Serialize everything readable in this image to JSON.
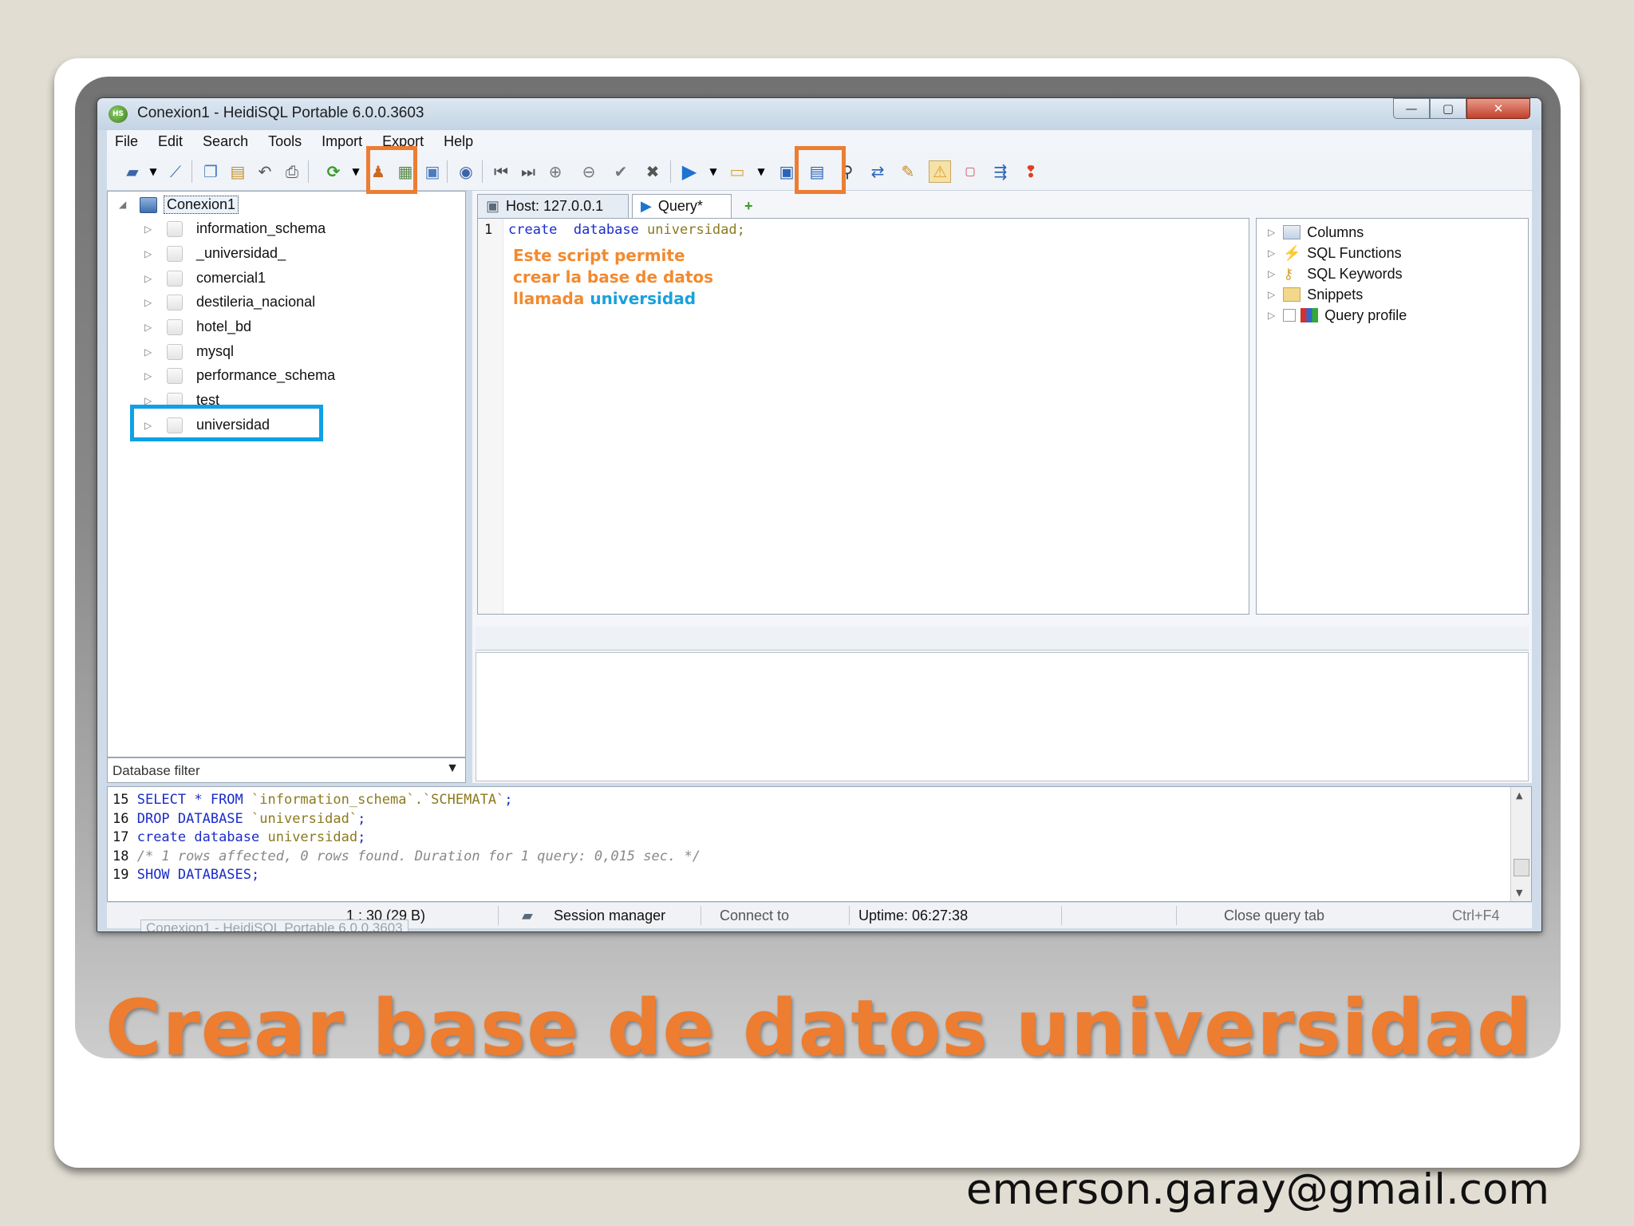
{
  "window": {
    "title": "Conexion1 - HeidiSQL Portable 6.0.0.3603",
    "icon_text": "HS",
    "controls": {
      "minimize": "—",
      "maximize": "▢",
      "close": "✕"
    }
  },
  "menu": [
    "File",
    "Edit",
    "Search",
    "Tools",
    "Import",
    "Export",
    "Help"
  ],
  "toolbar": {
    "icons": [
      "connect-icon",
      "dropdown-icon",
      "disconnect-icon",
      "copy-icon",
      "paste-icon",
      "undo-icon",
      "print-icon",
      "refresh-icon",
      "dropdown-icon",
      "user-manager-icon",
      "export-grid-icon",
      "import-icon",
      "help-icon",
      "first-record-icon",
      "last-record-icon",
      "insert-record-icon",
      "delete-record-icon",
      "post-icon",
      "cancel-icon",
      "run-query-icon",
      "dropdown-icon",
      "load-sql-icon",
      "dropdown-icon",
      "save-icon",
      "save-as-icon",
      "search-icon",
      "replace-icon",
      "format-icon",
      "warning-icon",
      "sql-log-icon",
      "wrap-icon",
      "stop-icon"
    ],
    "highlight_color_orange": "#ed7d31",
    "highlight_color_blue": "#0fa0e6"
  },
  "tree": {
    "root": "Conexion1",
    "databases": [
      "information_schema",
      "_universidad_",
      "comercial1",
      "destileria_nacional",
      "hotel_bd",
      "mysql",
      "performance_schema",
      "test",
      "universidad"
    ],
    "highlighted": "universidad"
  },
  "db_filter": {
    "placeholder": "Database filter",
    "arrow": "▼"
  },
  "tabs": {
    "host": "Host: 127.0.0.1",
    "query": "Query*",
    "add": "+"
  },
  "editor": {
    "line_number": "1",
    "code": {
      "kw1": "create",
      "kw2": "database",
      "ident": "universidad;"
    },
    "annotation": {
      "line1": "Este script permite",
      "line2": "crear la base de datos",
      "line3_prefix": "llamada",
      "line3_highlight": "universidad",
      "color": "#f28a30",
      "highlight_color": "#19a0dc"
    }
  },
  "helpers": [
    "Columns",
    "SQL Functions",
    "SQL Keywords",
    "Snippets",
    "Query profile"
  ],
  "log": [
    {
      "num": "15",
      "parts": [
        [
          "kw",
          "SELECT * FROM "
        ],
        [
          "str",
          "`information_schema`.`SCHEMATA`"
        ],
        [
          "kw",
          ";"
        ]
      ]
    },
    {
      "num": "16",
      "parts": [
        [
          "kw",
          "DROP DATABASE "
        ],
        [
          "str",
          "`universidad`"
        ],
        [
          "kw",
          ";"
        ]
      ]
    },
    {
      "num": "17",
      "parts": [
        [
          "kw",
          "create database "
        ],
        [
          "str",
          "universidad"
        ],
        [
          "kw",
          ";"
        ]
      ]
    },
    {
      "num": "18",
      "parts": [
        [
          "cmt",
          "/* 1 rows affected, 0 rows found. Duration for 1 query: 0,015 sec. */"
        ]
      ]
    },
    {
      "num": "19",
      "parts": [
        [
          "kw",
          "SHOW DATABASES;"
        ]
      ]
    }
  ],
  "status": {
    "cursor": "1 : 30 (29 B)",
    "session_manager": "Session manager",
    "connect_to": "Connect to",
    "uptime": "Uptime: 06:27:38",
    "close_query_tab": "Close query tab",
    "shortcut": "Ctrl+F4",
    "ghost_tab": "Conexion1 - HeidiSQL Portable 6.0.0.3603"
  },
  "slide": {
    "title": "Crear base de datos universidad",
    "title_color": "#ed7d31",
    "email": "emerson.garay@gmail.com"
  }
}
